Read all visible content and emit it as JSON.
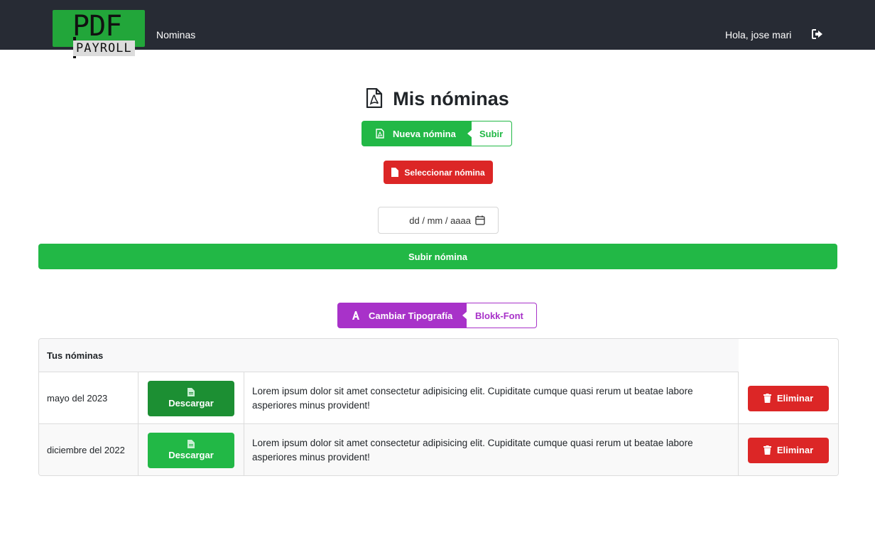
{
  "navbar": {
    "logo_top": "PDF",
    "logo_bottom": "PAYROLL",
    "nav_link": "Nominas",
    "greeting": "Hola, jose mari",
    "logout_icon": "sign-out-icon"
  },
  "page": {
    "title": "Mis nóminas",
    "title_icon": "file-pdf-icon"
  },
  "upload": {
    "new_label": "Nueva nómina",
    "new_action": "Subir",
    "select_label": "Seleccionar nómina",
    "date_placeholder": "dd / mm / aaaa",
    "submit_label": "Subir nómina"
  },
  "font_toggle": {
    "label": "Cambiar Tipografía",
    "value": "Blokk-Font"
  },
  "table": {
    "header": "Tus nóminas",
    "rows": [
      {
        "date": "mayo del 2023",
        "download_label": "Descargar",
        "description": "Lorem ipsum dolor sit amet consectetur adipisicing elit. Cupiditate cumque quasi rerum ut beatae labore asperiores minus provident!",
        "delete_label": "Eliminar"
      },
      {
        "date": "diciembre del 2022",
        "download_label": "Descargar",
        "description": "Lorem ipsum dolor sit amet consectetur adipisicing elit. Cupiditate cumque quasi rerum ut beatae labore asperiores minus provident!",
        "delete_label": "Eliminar"
      }
    ]
  },
  "colors": {
    "navbar": "#272b34",
    "green": "#22b846",
    "dark_green": "#1c8f33",
    "red": "#dc2626",
    "purple": "#a832c9"
  }
}
